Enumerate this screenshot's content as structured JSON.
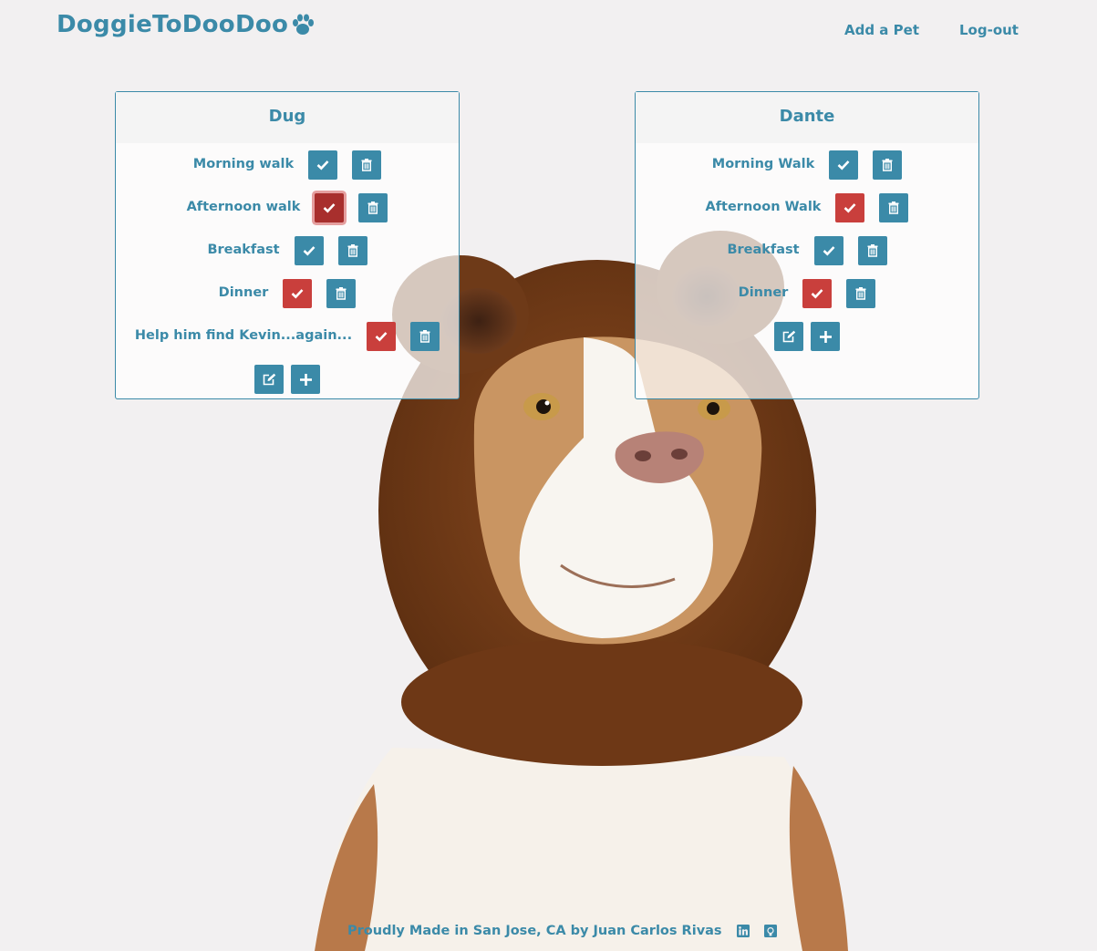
{
  "brand": {
    "title": "DoggieToDooDoo"
  },
  "nav": {
    "add_pet": "Add a Pet",
    "logout": "Log-out"
  },
  "pets": [
    {
      "name": "Dug",
      "tasks": [
        {
          "label": "Morning walk",
          "status": "pending"
        },
        {
          "label": "Afternoon walk",
          "status": "done"
        },
        {
          "label": "Breakfast",
          "status": "pending"
        },
        {
          "label": "Dinner",
          "status": "done"
        },
        {
          "label": "Help him find Kevin...again...",
          "status": "done"
        }
      ]
    },
    {
      "name": "Dante",
      "tasks": [
        {
          "label": "Morning Walk",
          "status": "pending"
        },
        {
          "label": "Afternoon Walk",
          "status": "done"
        },
        {
          "label": "Breakfast",
          "status": "pending"
        },
        {
          "label": "Dinner",
          "status": "done"
        }
      ]
    }
  ],
  "footer": {
    "text": "Proudly Made in San Jose, CA by Juan Carlos Rivas"
  },
  "icons": {
    "brand": "paw-icon",
    "complete": "check-icon",
    "delete": "trash-icon",
    "edit": "edit-icon",
    "add": "plus-icon",
    "social_1": "linkedin-icon",
    "social_2": "github-icon"
  },
  "colors": {
    "accent": "#3b8aa8",
    "done": "#c93f3c",
    "background": "#f2f0f1"
  }
}
